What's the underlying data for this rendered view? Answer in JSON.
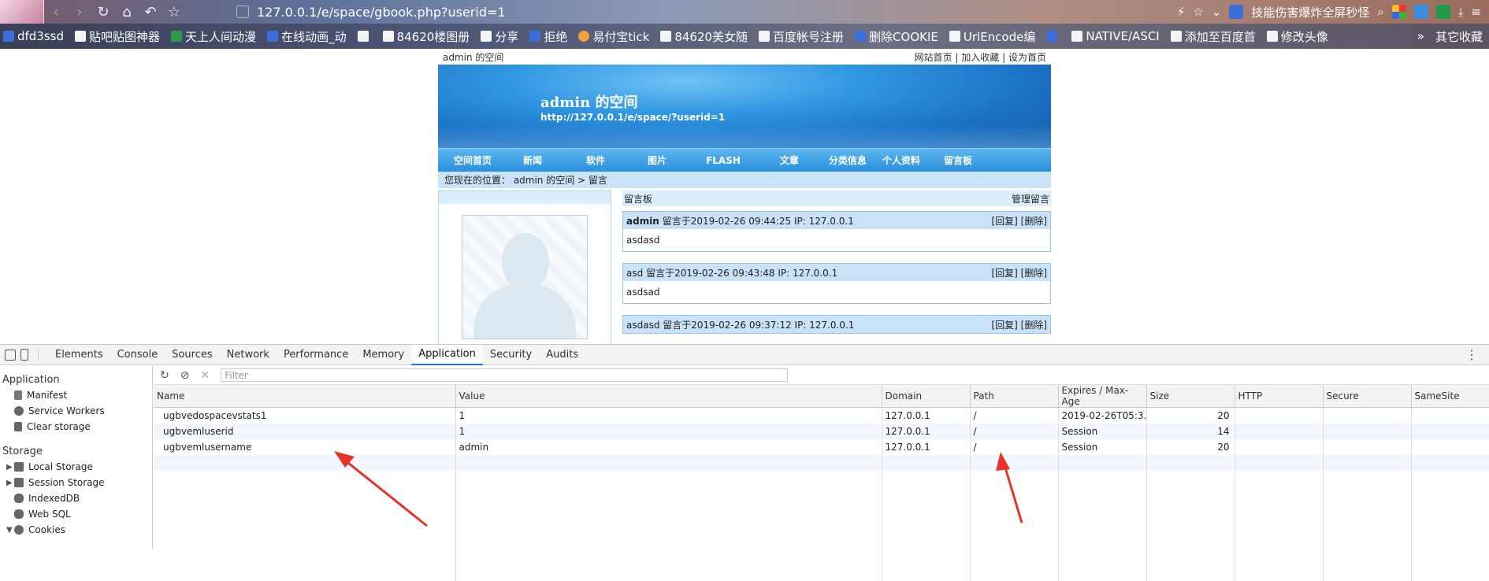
{
  "browser": {
    "url": "127.0.0.1/e/space/gbook.php?userid=1",
    "extension_text": "技能伤害爆炸全屏秒怪",
    "bookmarks": [
      "dfd3ssd",
      "贴吧贴图神器",
      "天上人间动漫",
      "在线动画_动",
      "",
      "84620楼图册",
      "分享",
      "拒绝",
      "易付宝tick",
      "84620美女随",
      "百度帐号注册",
      "删除COOKIE",
      "UrlEncode编",
      "",
      "NATIVE/ASCI",
      "添加至百度首",
      "修改头像"
    ],
    "bookmarks_more": "»",
    "bookmarks_other": "其它收藏"
  },
  "site": {
    "top_left": "admin 的空间",
    "top_links": [
      "网站首页",
      "|",
      "加入收藏",
      "|",
      "设为首页"
    ],
    "title": "admin 的空间",
    "space_url": "http://127.0.0.1/e/space/?userid=1",
    "menu": [
      "空间首页",
      "新闻",
      "软件",
      "图片",
      "FLASH",
      "文章",
      "分类信息",
      "个人资料",
      "留言板"
    ],
    "crumb": "您现在的位置： admin 的空间 > 留言",
    "gbook_title": "留言板",
    "gbook_manage": "管理留言",
    "messages": [
      {
        "user": "admin",
        "meta": "留言于2019-02-26 09:44:25 IP: 127.0.0.1",
        "actions": "[回复] [删除]",
        "body": "asdasd"
      },
      {
        "user": "asd",
        "meta": "留言于2019-02-26 09:43:48 IP: 127.0.0.1",
        "actions": "[回复] [删除]",
        "body": "asdsad"
      },
      {
        "user": "asdasd",
        "meta": "留言于2019-02-26 09:37:12 IP: 127.0.0.1",
        "actions": "[回复] [删除]",
        "body": ""
      }
    ]
  },
  "devtools": {
    "tabs": [
      "Elements",
      "Console",
      "Sources",
      "Network",
      "Performance",
      "Memory",
      "Application",
      "Security",
      "Audits"
    ],
    "active_tab": "Application",
    "sidebar": {
      "application_header": "Application",
      "application_items": [
        "Manifest",
        "Service Workers",
        "Clear storage"
      ],
      "storage_header": "Storage",
      "storage_items": [
        "Local Storage",
        "Session Storage",
        "IndexedDB",
        "Web SQL",
        "Cookies"
      ]
    },
    "filter_placeholder": "Filter",
    "columns": [
      "Name",
      "Value",
      "Domain",
      "Path",
      "Expires / Max-Age",
      "Size",
      "HTTP",
      "Secure",
      "SameSite"
    ],
    "cookies": [
      {
        "name": "ugbvedospacevstats1",
        "value": "1",
        "domain": "127.0.0.1",
        "path": "/",
        "expires": "2019-02-26T05:3...",
        "size": "20",
        "http": "",
        "secure": "",
        "samesite": ""
      },
      {
        "name": "ugbvemluserid",
        "value": "1",
        "domain": "127.0.0.1",
        "path": "/",
        "expires": "Session",
        "size": "14",
        "http": "",
        "secure": "",
        "samesite": ""
      },
      {
        "name": "ugbvemlusername",
        "value": "admin",
        "domain": "127.0.0.1",
        "path": "/",
        "expires": "Session",
        "size": "20",
        "http": "",
        "secure": "",
        "samesite": ""
      }
    ]
  },
  "annotation_color": "#e8322a"
}
